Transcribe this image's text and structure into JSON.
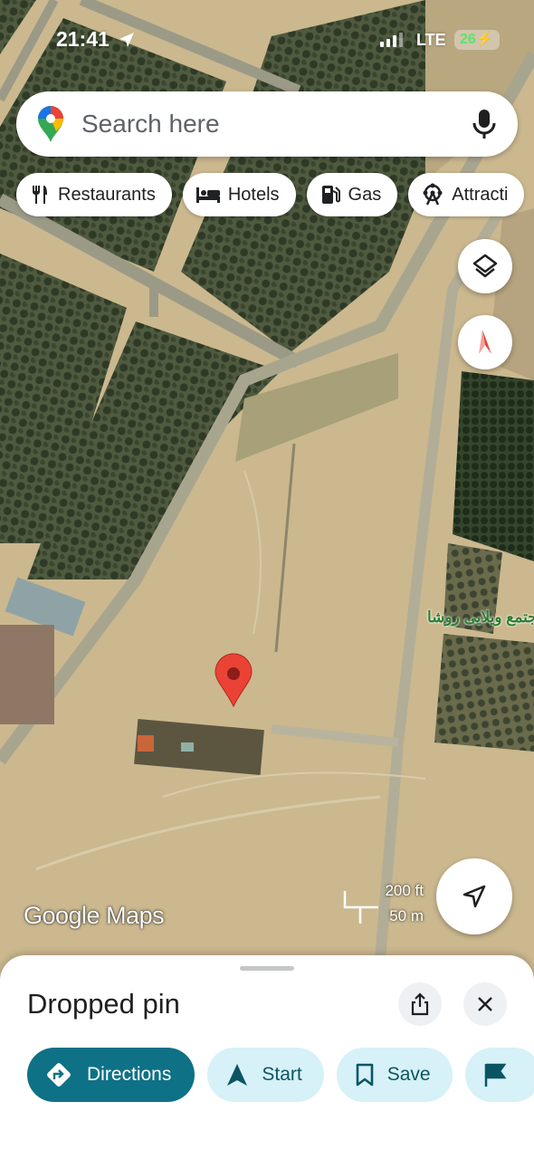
{
  "status_bar": {
    "time": "21:41",
    "network": "LTE",
    "battery": "26",
    "location_icon": "location-arrow-icon",
    "signal_icon": "signal-bars-icon"
  },
  "search": {
    "placeholder": "Search here",
    "logo_icon": "google-maps-pin-icon",
    "mic_icon": "microphone-icon"
  },
  "chips": [
    {
      "label": "Restaurants",
      "icon": "fork-knife-icon"
    },
    {
      "label": "Hotels",
      "icon": "bed-icon"
    },
    {
      "label": "Gas",
      "icon": "gas-pump-icon"
    },
    {
      "label": "Attracti",
      "icon": "ferris-wheel-icon"
    }
  ],
  "map": {
    "place_label": "مجتمع ویلایی روشا",
    "scale_ft": "200 ft",
    "scale_m": "50 m",
    "watermark": "Google Maps",
    "layers_icon": "layers-icon",
    "compass_icon": "compass-icon",
    "my_location_icon": "navigation-arrow-icon",
    "pin_color": "#ea4335"
  },
  "sheet": {
    "title": "Dropped pin",
    "share_icon": "share-icon",
    "close_icon": "close-icon",
    "actions": [
      {
        "label": "Directions",
        "icon": "directions-diamond-icon"
      },
      {
        "label": "Start",
        "icon": "navigation-arrow-icon"
      },
      {
        "label": "Save",
        "icon": "bookmark-icon"
      },
      {
        "label": "",
        "icon": "flag-icon"
      }
    ],
    "accent": "#0e7186"
  }
}
